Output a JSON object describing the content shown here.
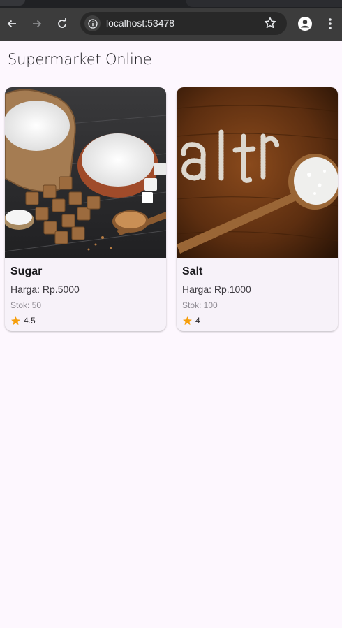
{
  "browser": {
    "url": "localhost:53478",
    "icons": [
      "back-icon",
      "forward-icon",
      "reload-icon",
      "site-info-icon",
      "bookmark-star-icon",
      "profile-icon",
      "menu-icon"
    ]
  },
  "page": {
    "title": "Supermarket Online"
  },
  "products": [
    {
      "name": "Sugar",
      "price": "Harga: Rp.5000",
      "stock": "Stok: 50",
      "rating": "4.5",
      "image": "sugar-photo"
    },
    {
      "name": "Salt",
      "price": "Harga: Rp.1000",
      "stock": "Stok: 100",
      "rating": "4",
      "image": "salt-photo"
    }
  ],
  "colors": {
    "background": "#fdf7fe",
    "card": "#f7f2f9",
    "star": "#f59e0b",
    "toolbar": "#3c3c3c"
  }
}
